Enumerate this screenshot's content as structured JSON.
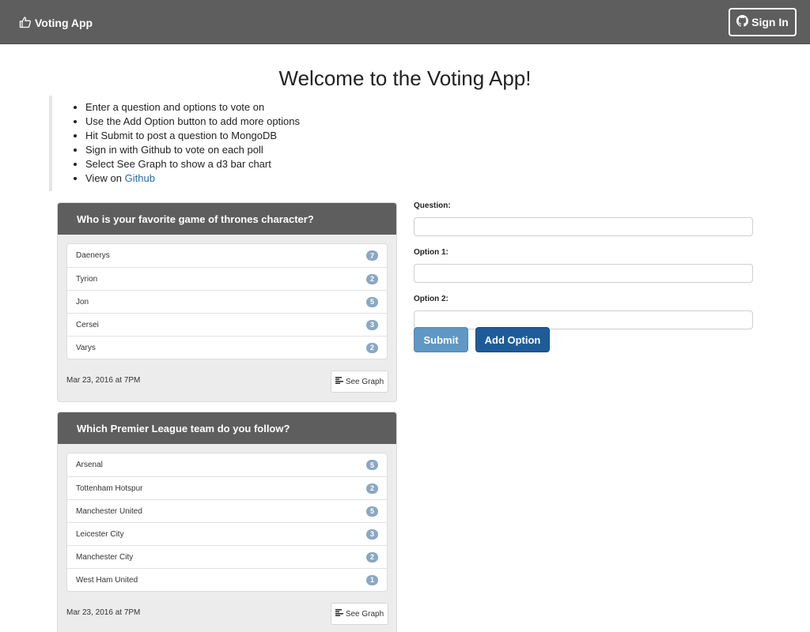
{
  "navbar": {
    "brand": "Voting App",
    "brand_icon": "thumbs-up-icon",
    "signin_label": "Sign In",
    "signin_icon": "github-icon"
  },
  "page_title": "Welcome to the Voting App!",
  "instructions": {
    "items": [
      "Enter a question and options to vote on",
      "Use the Add Option button to add more options",
      "Hit Submit to post a question to MongoDB",
      "Sign in with Github to vote on each poll",
      "Select See Graph to show a d3 bar chart"
    ],
    "view_prefix": "View on",
    "github_link": "Github"
  },
  "polls": [
    {
      "question": "Who is your favorite game of thrones character?",
      "options": [
        {
          "label": "Daenerys",
          "votes": "7"
        },
        {
          "label": "Tyrion",
          "votes": "2"
        },
        {
          "label": "Jon",
          "votes": "5"
        },
        {
          "label": "Cersei",
          "votes": "3"
        },
        {
          "label": "Varys",
          "votes": "2"
        }
      ],
      "timestamp": "Mar 23, 2016 at 7PM",
      "graph_label": "See Graph"
    },
    {
      "question": "Which Premier League team do you follow?",
      "options": [
        {
          "label": "Arsenal",
          "votes": "5"
        },
        {
          "label": "Tottenham Hotspur",
          "votes": "2"
        },
        {
          "label": "Manchester United",
          "votes": "5"
        },
        {
          "label": "Leicester City",
          "votes": "3"
        },
        {
          "label": "Manchester City",
          "votes": "2"
        },
        {
          "label": "West Ham United",
          "votes": "1"
        }
      ],
      "timestamp": "Mar 23, 2016 at 7PM",
      "graph_label": "See Graph"
    }
  ],
  "form": {
    "question_label": "Question:",
    "question_value": "",
    "option1_label": "Option 1:",
    "option1_value": "",
    "option2_label": "Option 2:",
    "option2_value": "",
    "submit_label": "Submit",
    "add_option_label": "Add Option"
  },
  "colors": {
    "navbar": "#5e5e5e",
    "poll_header": "#5e5e5e",
    "badge": "#8aa8c3",
    "submit": "#5f97c5",
    "add_option": "#1e5c99",
    "link": "#2a6aa8"
  }
}
